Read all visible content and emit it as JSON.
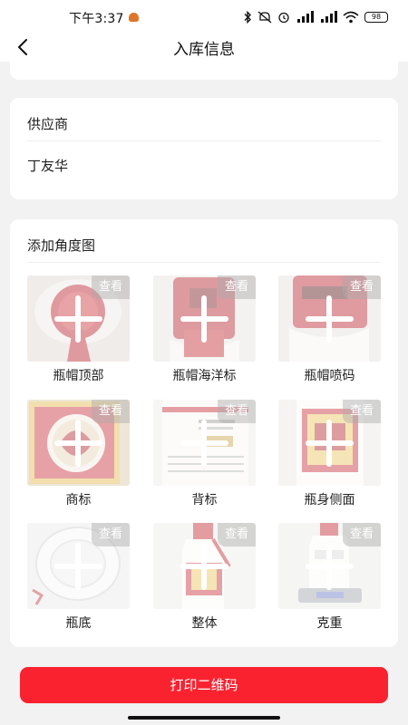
{
  "status_bar": {
    "time": "下午3:37",
    "battery": "98"
  },
  "nav": {
    "title": "入库信息"
  },
  "supplier": {
    "label": "供应商",
    "value": "丁友华"
  },
  "angles": {
    "heading": "添加角度图",
    "view_label": "查看",
    "items": [
      {
        "label": "瓶帽顶部",
        "photo": "red-cap-top"
      },
      {
        "label": "瓶帽海洋标",
        "photo": "red-cap-side-seal"
      },
      {
        "label": "瓶帽喷码",
        "photo": "red-cap-print-code"
      },
      {
        "label": "商标",
        "photo": "front-label-emblem"
      },
      {
        "label": "背标",
        "photo": "back-label"
      },
      {
        "label": "瓶身侧面",
        "photo": "bottle-side"
      },
      {
        "label": "瓶底",
        "photo": "bottle-bottom"
      },
      {
        "label": "整体",
        "photo": "whole-bottle"
      },
      {
        "label": "克重",
        "photo": "bottle-on-scale"
      }
    ]
  },
  "actions": {
    "print_label": "打印二维码"
  },
  "colors": {
    "accent": "#fb2230",
    "background": "#f2f2f2"
  }
}
